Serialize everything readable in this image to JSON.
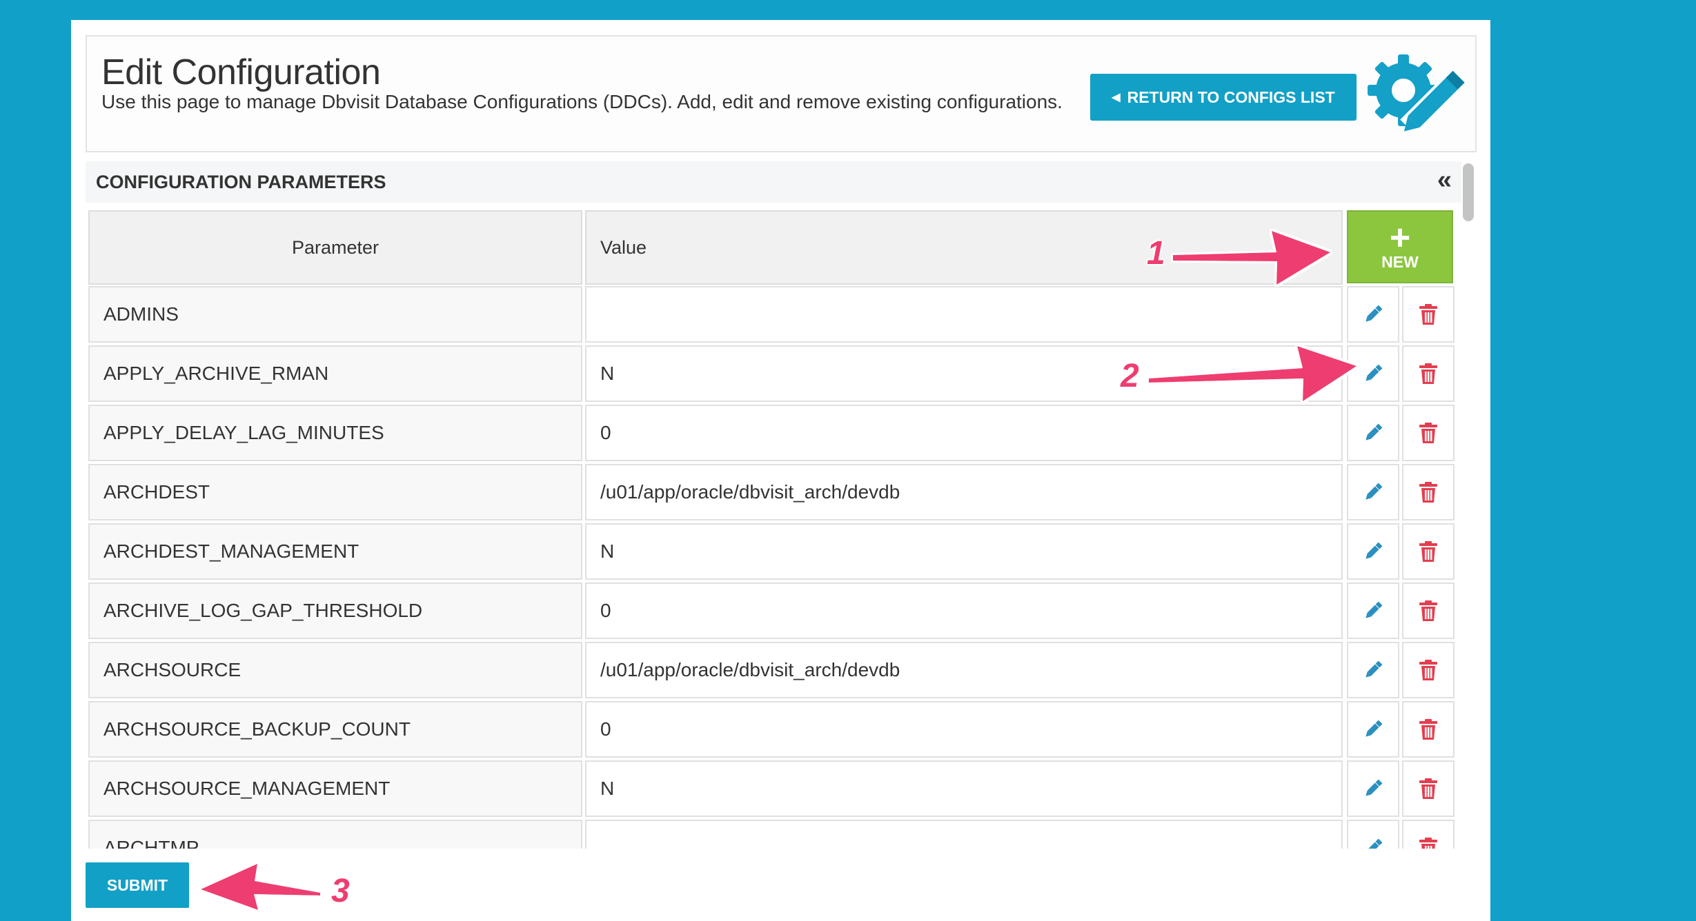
{
  "header": {
    "title": "Edit Configuration",
    "description": "Use this page to manage Dbvisit Database Configurations (DDCs). Add, edit and remove existing configurations.",
    "return_label": "RETURN TO CONFIGS LIST"
  },
  "section": {
    "title": "CONFIGURATION PARAMETERS"
  },
  "table": {
    "col_parameter": "Parameter",
    "col_value": "Value",
    "new_label": "NEW",
    "rows": [
      {
        "param": "ADMINS",
        "value": ""
      },
      {
        "param": "APPLY_ARCHIVE_RMAN",
        "value": "N"
      },
      {
        "param": "APPLY_DELAY_LAG_MINUTES",
        "value": "0"
      },
      {
        "param": "ARCHDEST",
        "value": "/u01/app/oracle/dbvisit_arch/devdb"
      },
      {
        "param": "ARCHDEST_MANAGEMENT",
        "value": "N"
      },
      {
        "param": "ARCHIVE_LOG_GAP_THRESHOLD",
        "value": "0"
      },
      {
        "param": "ARCHSOURCE",
        "value": "/u01/app/oracle/dbvisit_arch/devdb"
      },
      {
        "param": "ARCHSOURCE_BACKUP_COUNT",
        "value": "0"
      },
      {
        "param": "ARCHSOURCE_MANAGEMENT",
        "value": "N"
      },
      {
        "param": "ARCHTMP",
        "value": ""
      }
    ]
  },
  "submit_label": "SUBMIT",
  "annotations": {
    "n1": "1",
    "n2": "2",
    "n3": "3"
  },
  "colors": {
    "background": "#11a0c8",
    "primary": "#12a0c6",
    "new": "#8cc63f",
    "delete": "#e33e4f",
    "edit": "#2b8fc0",
    "annotation": "#ee3d70"
  },
  "icons": {
    "return": "left-triangle-icon",
    "collapse": "double-chevron-left-icon",
    "edit": "pencil-icon",
    "delete": "trash-icon",
    "logo": "gear-pencil-icon"
  }
}
